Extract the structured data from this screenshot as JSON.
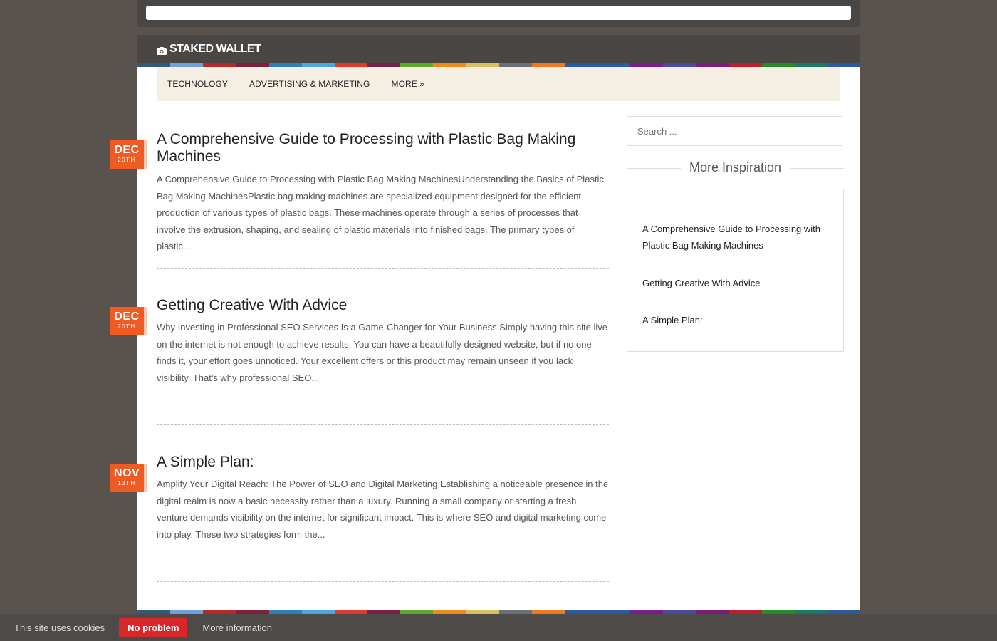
{
  "site": {
    "brand": "STAKED WALLET"
  },
  "colors": {
    "stripe": [
      "#315a7c",
      "#6fa0d8",
      "#b82a2a",
      "#7f1f3a",
      "#2d7fb8",
      "#4aa8e0",
      "#e23a2a",
      "#7a1e4e",
      "#5aab2a",
      "#f08a1a",
      "#d8c060",
      "#6a6f7a",
      "#f07a20",
      "#2a5aa0",
      "#2a5aa0",
      "#7a1e8a",
      "#4a4aa0",
      "#7a1e7a",
      "#c01e2a",
      "#2a8a2a",
      "#1a7a6a",
      "#2a5aa0"
    ],
    "date_badge": "#f05a23",
    "cookie_button": "#d9262b"
  },
  "nav": {
    "items": [
      "TECHNOLOGY",
      "ADVERTISING & MARKETING",
      "MORE »"
    ]
  },
  "posts": [
    {
      "month": "DEC",
      "day": "20TH",
      "title": "A Comprehensive Guide to Processing with Plastic Bag Making Machines",
      "excerpt": "A Comprehensive Guide to Processing with Plastic Bag Making MachinesUnderstanding the Basics of Plastic Bag Making MachinesPlastic bag making machines are specialized equipment designed for the efficient production of various types of plastic bags. These machines operate through a series of processes that involve the extrusion, shaping, and sealing of plastic materials into finished bags. The primary types of plastic..."
    },
    {
      "month": "DEC",
      "day": "20TH",
      "title": "Getting Creative With Advice",
      "excerpt": "Why Investing in Professional SEO Services Is a Game-Changer for Your Business Simply having this site live on the internet is not enough to achieve results. You can have a beautifully designed website, but if no one finds it, your effort goes unnoticed. Your excellent offers or this product may remain unseen if you lack visibility. That's why professional SEO..."
    },
    {
      "month": "NOV",
      "day": "13TH",
      "title": "A Simple Plan:",
      "excerpt": "Amplify Your Digital Reach: The Power of SEO and Digital Marketing Establishing a noticeable presence in the digital realm is now a basic necessity rather than a luxury. Running a small company or starting a fresh venture demands visibility on the internet for significant impact. This is where SEO and digital marketing come into play. These two strategies form the..."
    }
  ],
  "sidebar": {
    "search_placeholder": "Search ...",
    "widget_title": "More Inspiration",
    "links": [
      "A Comprehensive Guide to Processing with Plastic Bag Making Machines",
      "Getting Creative With Advice",
      "A Simple Plan:"
    ]
  },
  "cookie": {
    "text": "This site uses cookies",
    "button": "No problem",
    "more": "More information"
  }
}
